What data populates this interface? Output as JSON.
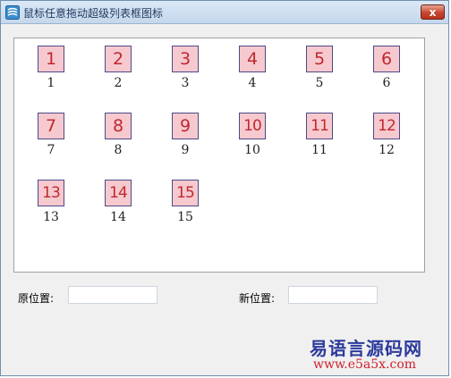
{
  "window": {
    "title": "鼠标任意拖动超级列表框图标",
    "close_label": "x",
    "icon": "app-icon"
  },
  "listview": {
    "items": [
      {
        "icon_text": "1",
        "label": "1"
      },
      {
        "icon_text": "2",
        "label": "2"
      },
      {
        "icon_text": "3",
        "label": "3"
      },
      {
        "icon_text": "4",
        "label": "4"
      },
      {
        "icon_text": "5",
        "label": "5"
      },
      {
        "icon_text": "6",
        "label": "6"
      },
      {
        "icon_text": "7",
        "label": "7"
      },
      {
        "icon_text": "8",
        "label": "8"
      },
      {
        "icon_text": "9",
        "label": "9"
      },
      {
        "icon_text": "10",
        "label": "10"
      },
      {
        "icon_text": "11",
        "label": "11"
      },
      {
        "icon_text": "12",
        "label": "12"
      },
      {
        "icon_text": "13",
        "label": "13"
      },
      {
        "icon_text": "14",
        "label": "14"
      },
      {
        "icon_text": "15",
        "label": "15"
      }
    ]
  },
  "form": {
    "original_position_label": "原位置:",
    "original_position_value": "",
    "new_position_label": "新位置:",
    "new_position_value": ""
  },
  "watermark": {
    "site_name": "易语言源码网",
    "url": "www.e5a5x.com"
  },
  "colors": {
    "icon_fill": "#f6c9cf",
    "icon_text": "#c0282f",
    "icon_border": "#4c4a86",
    "watermark_blue": "#2c3a9c",
    "watermark_red": "#d0202e"
  }
}
